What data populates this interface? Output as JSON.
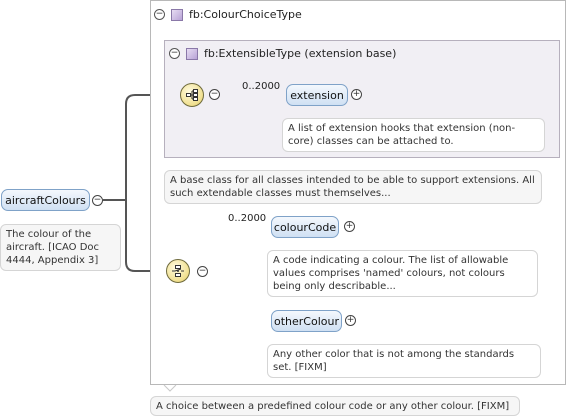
{
  "root": {
    "name": "aircraftColours",
    "note": "The colour of the aircraft. [ICAO Doc 4444, Appendix 3]"
  },
  "outer_type": {
    "label": "fb:ColourChoiceType",
    "note": "A choice between a predefined colour code or any other colour. [FIXM]"
  },
  "inner_type": {
    "label": "fb:ExtensibleType (extension base)",
    "note": "A base class for all classes intended to be able to support extensions. All such extendable classes must themselves..."
  },
  "sequence": {
    "multiplicity": "0..2000",
    "element": {
      "name": "extension",
      "note": "A list of extension hooks that extension (non-core) classes can be attached to."
    }
  },
  "choice": {
    "multiplicity": "0..2000",
    "elements": [
      {
        "name": "colourCode",
        "note": "A code indicating a colour. The list of allowable values comprises 'named' colours, not colours being only describable..."
      },
      {
        "name": "otherColour",
        "note": "Any other color that is not among the standards set. [FIXM]"
      }
    ]
  },
  "symbols": {
    "collapse": "⊖",
    "expand": "+",
    "minus": "−"
  }
}
